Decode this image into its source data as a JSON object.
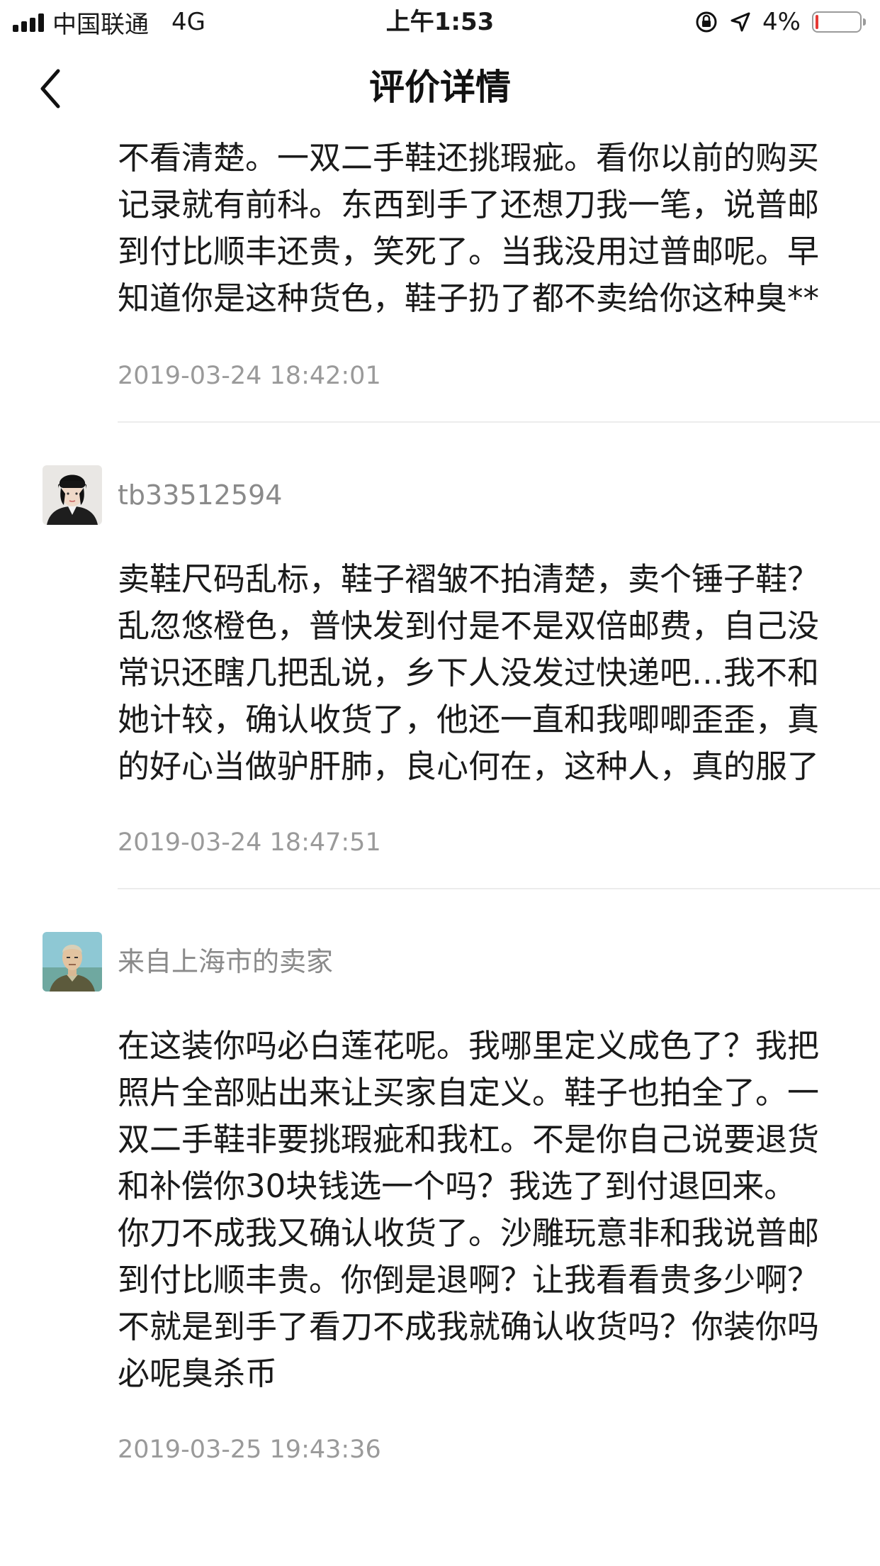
{
  "status_bar": {
    "carrier": "中国联通",
    "network": "4G",
    "time": "上午1:53",
    "battery": "4%",
    "battery_level": 0.04,
    "battery_color": "#e53935"
  },
  "nav": {
    "title": "评价详情",
    "back_icon": "chevron-left-icon"
  },
  "comments": [
    {
      "text": "不看清楚。一双二手鞋还挑瑕疵。看你以前的购买记录就有前科。东西到手了还想刀我一笔，说普邮到付比顺丰还贵，笑死了。当我没用过普邮呢。早知道你是这种货色，鞋子扔了都不卖给你这种臭**",
      "time": "2019-03-24 18:42:01"
    },
    {
      "author": "tb33512594",
      "text": "卖鞋尺码乱标，鞋子褶皱不拍清楚，卖个锤子鞋？乱忽悠橙色，普快发到付是不是双倍邮费，自己没常识还瞎几把乱说，乡下人没发过快递吧…我不和她计较，确认收货了，他还一直和我唧唧歪歪，真的好心当做驴肝肺，良心何在，这种人，真的服了",
      "time": "2019-03-24 18:47:51"
    },
    {
      "author": "来自上海市的卖家",
      "text": "在这装你吗必白莲花呢。我哪里定义成色了？我把照片全部贴出来让买家自定义。鞋子也拍全了。一双二手鞋非要挑瑕疵和我杠。不是你自己说要退货和补偿你30块钱选一个吗？我选了到付退回来。你刀不成我又确认收货了。沙雕玩意非和我说普邮到付比顺丰贵。你倒是退啊？让我看看贵多少啊？不就是到手了看刀不成我就确认收货吗？你装你吗必呢臭杀币",
      "time": "2019-03-25 19:43:36"
    }
  ]
}
